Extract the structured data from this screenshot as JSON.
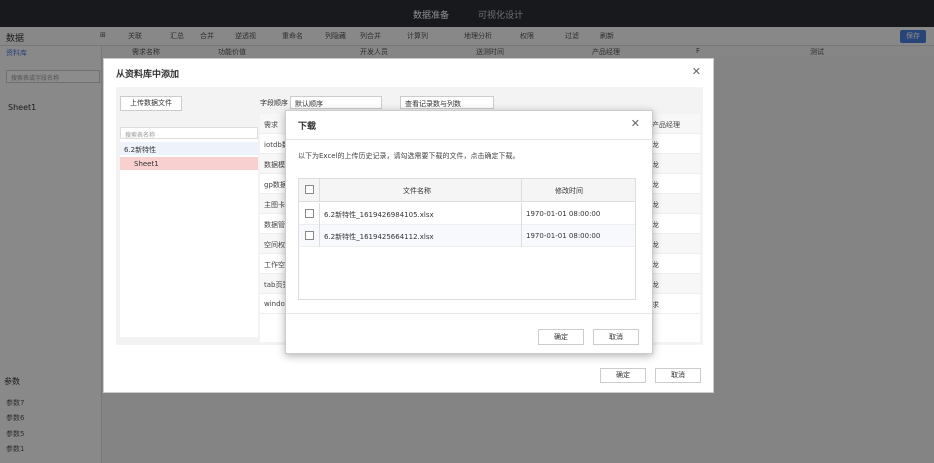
{
  "topbar": {
    "tab_prep": "数据准备",
    "tab_vis": "可视化设计"
  },
  "toolbar": {
    "title": "数据",
    "tools": [
      "关联",
      "汇总",
      "合并",
      "逆透视",
      "重命名",
      "列隐藏",
      "列合并",
      "计算列",
      "地理分析",
      "权限",
      "过滤",
      "刷新"
    ],
    "save": "保存"
  },
  "left": {
    "lib_label": "资料库",
    "search_placeholder": "搜索表或字段名称",
    "sheet": "Sheet1",
    "params_title": "参数",
    "params": [
      "参数7",
      "参数6",
      "参数5",
      "参数1"
    ]
  },
  "columns": [
    "需求名称",
    "功能价值",
    "开发人员",
    "送测时间",
    "产品经理",
    "F",
    "测试"
  ],
  "outer": {
    "title": "从资料库中添加",
    "upload": "上传数据文件",
    "tree_search": "搜索表名称",
    "folder": "6.2新特性",
    "leaf": "Sheet1",
    "order_label": "字段顺序",
    "order_value": "默认顺序",
    "view_btn": "查看记录数与列数",
    "rows": [
      "需求",
      "iotdb数",
      "数据模",
      "gp数据",
      "主图卡",
      "数据管",
      "空间权",
      "工作空",
      "tab页签",
      "window"
    ],
    "right_col": [
      "产品经理",
      "龙",
      "龙",
      "龙",
      "龙",
      "龙",
      "龙",
      "龙",
      "龙",
      "求"
    ],
    "ok": "确定",
    "cancel": "取消"
  },
  "inner": {
    "title": "下载",
    "hint": "以下为Excel的上传历史记录，请勾选需要下载的文件，点击确定下载。",
    "col_name": "文件名称",
    "col_time": "修改时间",
    "files": [
      {
        "name": "6.2新特性_1619426984105.xlsx",
        "time": "1970-01-01 08:00:00"
      },
      {
        "name": "6.2新特性_1619425664112.xlsx",
        "time": "1970-01-01 08:00:00"
      }
    ],
    "ok": "确定",
    "cancel": "取消"
  }
}
